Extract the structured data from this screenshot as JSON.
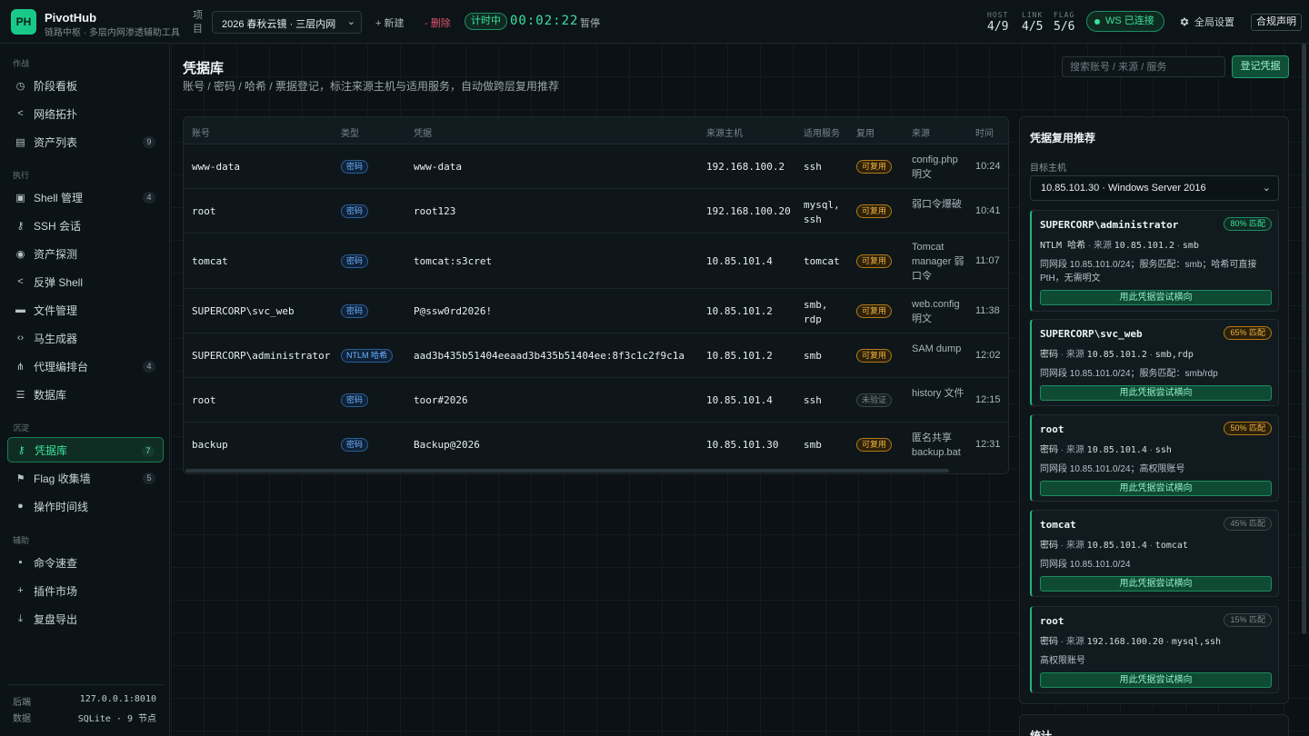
{
  "app": {
    "logo": "PH",
    "name": "PivotHub",
    "subtitle": "链路中枢 · 多层内网渗透辅助工具",
    "project_label": "项目",
    "project_value": "2026 春秋云镜 · 三层内网",
    "new_label": "+ 新建",
    "delete_label": "- 删除",
    "timer_status": "计时中",
    "timer_value": "00:02:22",
    "pause_label": "暂停",
    "stats": [
      {
        "key": "HOST",
        "value": "4/9"
      },
      {
        "key": "LINK",
        "value": "4/5"
      },
      {
        "key": "FLAG",
        "value": "5/6"
      }
    ],
    "ws_status": "WS 已连接",
    "settings_label": "全局设置",
    "compliance_label": "合规声明"
  },
  "sidebar": {
    "sections": [
      "作战",
      "执行",
      "沉淀",
      "辅助"
    ],
    "items": [
      {
        "label": "阶段看板",
        "icon": "history-icon",
        "count": ""
      },
      {
        "label": "网络拓扑",
        "icon": "share-icon",
        "count": ""
      },
      {
        "label": "资产列表",
        "icon": "server-icon",
        "count": "9"
      },
      {
        "label": "Shell 管理",
        "icon": "terminal-icon",
        "count": "4"
      },
      {
        "label": "SSH 会话",
        "icon": "key-icon",
        "count": ""
      },
      {
        "label": "资产探测",
        "icon": "radar-icon",
        "count": ""
      },
      {
        "label": "反弹 Shell",
        "icon": "share-icon",
        "count": ""
      },
      {
        "label": "文件管理",
        "icon": "folder-icon",
        "count": ""
      },
      {
        "label": "马生成器",
        "icon": "code-icon",
        "count": ""
      },
      {
        "label": "代理编排台",
        "icon": "network-icon",
        "count": "4"
      },
      {
        "label": "数据库",
        "icon": "database-icon",
        "count": ""
      },
      {
        "label": "凭据库",
        "icon": "key-icon",
        "count": "7"
      },
      {
        "label": "Flag 收集墙",
        "icon": "flag-icon",
        "count": "5"
      },
      {
        "label": "操作时间线",
        "icon": "circle-icon",
        "count": ""
      },
      {
        "label": "命令速查",
        "icon": "note-icon",
        "count": ""
      },
      {
        "label": "插件市场",
        "icon": "plus-icon",
        "count": ""
      },
      {
        "label": "复盘导出",
        "icon": "download-icon",
        "count": ""
      }
    ],
    "footer": [
      {
        "label": "后端",
        "value": "127.0.0.1:8010"
      },
      {
        "label": "数据",
        "value": "SQLite · 9 节点"
      }
    ]
  },
  "page": {
    "title": "凭据库",
    "subtitle": "账号 / 密码 / 哈希 / 票据登记，标注来源主机与适用服务，自动做跨层复用推荐",
    "search_placeholder": "搜索账号 / 来源 / 服务",
    "register_label": "登记凭据"
  },
  "table": {
    "headers": [
      "账号",
      "类型",
      "凭据",
      "来源主机",
      "适用服务",
      "复用",
      "来源",
      "时间"
    ],
    "rows": [
      {
        "account": "www-data",
        "type": "密码",
        "secret": "www-data",
        "host": "192.168.100.2",
        "service": "ssh",
        "reuse": "可复用",
        "reuse_ok": true,
        "source": "config.php 明文",
        "time": "10:24"
      },
      {
        "account": "root",
        "type": "密码",
        "secret": "root123",
        "host": "192.168.100.20",
        "service": "mysql, ssh",
        "reuse": "可复用",
        "reuse_ok": true,
        "source": "弱口令爆破",
        "time": "10:41"
      },
      {
        "account": "tomcat",
        "type": "密码",
        "secret": "tomcat:s3cret",
        "host": "10.85.101.4",
        "service": "tomcat",
        "reuse": "可复用",
        "reuse_ok": true,
        "source": "Tomcat manager 弱口令",
        "time": "11:07"
      },
      {
        "account": "SUPERCORP\\svc_web",
        "type": "密码",
        "secret": "P@ssw0rd2026!",
        "host": "10.85.101.2",
        "service": "smb, rdp",
        "reuse": "可复用",
        "reuse_ok": true,
        "source": "web.config 明文",
        "time": "11:38"
      },
      {
        "account": "SUPERCORP\\administrator",
        "type": "NTLM 哈希",
        "secret": "aad3b435b51404eeaad3b435b51404ee:8f3c1c2f9c1a ...",
        "host": "10.85.101.2",
        "service": "smb",
        "reuse": "可复用",
        "reuse_ok": true,
        "source": "SAM dump",
        "time": "12:02"
      },
      {
        "account": "root",
        "type": "密码",
        "secret": "toor#2026",
        "host": "10.85.101.4",
        "service": "ssh",
        "reuse": "未验证",
        "reuse_ok": false,
        "source": "history 文件",
        "time": "12:15"
      },
      {
        "account": "backup",
        "type": "密码",
        "secret": "Backup@2026",
        "host": "10.85.101.30",
        "service": "smb",
        "reuse": "可复用",
        "reuse_ok": true,
        "source": "匿名共享 backup.bat",
        "time": "12:31"
      }
    ]
  },
  "reco": {
    "title": "凭据复用推荐",
    "target_label": "目标主机",
    "target_value": "10.85.101.30 · Windows Server 2016",
    "button_label": "用此凭据尝试横向",
    "candidates": [
      {
        "name": "SUPERCORP\\administrator",
        "pct": "80% 匹配",
        "level": "high",
        "type": "NTLM 哈希",
        "src_label": "来源",
        "host": "10.85.101.2",
        "service": "smb",
        "note": "同网段 10.85.101.0/24；服务匹配：smb；哈希可直接 PtH，无需明文"
      },
      {
        "name": "SUPERCORP\\svc_web",
        "pct": "65% 匹配",
        "level": "mid",
        "type": "密码",
        "src_label": "来源",
        "host": "10.85.101.2",
        "service": "smb,rdp",
        "note": "同网段 10.85.101.0/24；服务匹配：smb/rdp"
      },
      {
        "name": "root",
        "pct": "50% 匹配",
        "level": "mid",
        "type": "密码",
        "src_label": "来源",
        "host": "10.85.101.4",
        "service": "ssh",
        "note": "同网段 10.85.101.0/24；高权限账号"
      },
      {
        "name": "tomcat",
        "pct": "45% 匹配",
        "level": "low",
        "type": "密码",
        "src_label": "来源",
        "host": "10.85.101.4",
        "service": "tomcat",
        "note": "同网段 10.85.101.0/24"
      },
      {
        "name": "root",
        "pct": "15% 匹配",
        "level": "low",
        "type": "密码",
        "src_label": "来源",
        "host": "192.168.100.20",
        "service": "mysql,ssh",
        "note": "高权限账号"
      }
    ]
  },
  "stats_card": {
    "title": "统计"
  },
  "colors": {
    "accent": "#3be19e",
    "bg": "#0b1115",
    "warn": "#f3b33d",
    "info": "#6fb2ff",
    "danger": "#e0556a"
  }
}
